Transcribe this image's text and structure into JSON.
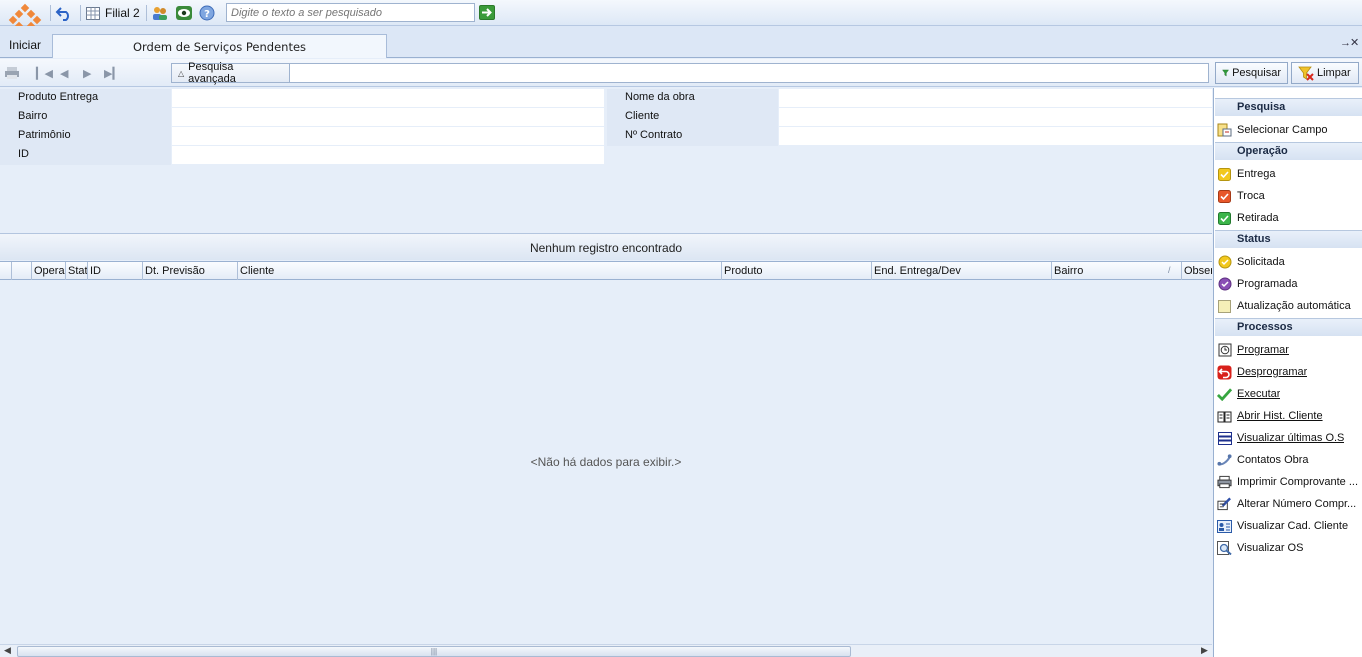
{
  "toolbar": {
    "filial_label": "Filial 2",
    "search_placeholder": "Digite o texto a ser pesquisado"
  },
  "nav": {
    "home_label": "Iniciar",
    "tab_label": "Ordem de Serviços Pendentes",
    "tab_close": "→✕"
  },
  "search_row": {
    "advanced_label": "Pesquisa avançada",
    "search_button": "Pesquisar",
    "clear_button": "Limpar"
  },
  "filters": {
    "produto_entrega": "Produto Entrega",
    "bairro": "Bairro",
    "patrimonio": "Patrimônio",
    "id": "ID",
    "nome_obra": "Nome da obra",
    "cliente": "Cliente",
    "contrato": "Nº Contrato"
  },
  "grid": {
    "status_text": "Nenhum registro encontrado",
    "columns": [
      "Opera",
      "Stat",
      "ID",
      "Dt. Previsão",
      "Cliente",
      "Produto",
      "End. Entrega/Dev",
      "Bairro",
      "Obser"
    ],
    "sort_indicator": "/",
    "empty_text": "<Não há dados para exibir.>",
    "scroll_grip": "|||"
  },
  "panel": {
    "pesquisa_title": "Pesquisa",
    "selecionar_campo": "Selecionar Campo",
    "operacao_title": "Operação",
    "entrega": "Entrega",
    "troca": "Troca",
    "retirada": "Retirada",
    "status_title": "Status",
    "solicitada": "Solicitada",
    "programada": "Programada",
    "atualizacao": "Atualização automática",
    "processos_title": "Processos",
    "programar": "Programar",
    "desprogramar": "Desprogramar",
    "executar": "Executar",
    "abrir_hist": "Abrir Hist. Cliente",
    "visualizar_ultimas": "Visualizar últimas O.S",
    "contatos_obra": "Contatos Obra",
    "imprimir": "Imprimir Comprovante ...",
    "alterar_numero": "Alterar Número Compr...",
    "visualizar_cad": "Visualizar Cad. Cliente",
    "visualizar_os": "Visualizar OS"
  },
  "colors": {
    "background": "#e6eef9",
    "entrega": "#f2c81e",
    "troca": "#e8572a",
    "retirada": "#3cb54a",
    "solicitada": "#f2c81e",
    "programada": "#8a4fb5"
  }
}
